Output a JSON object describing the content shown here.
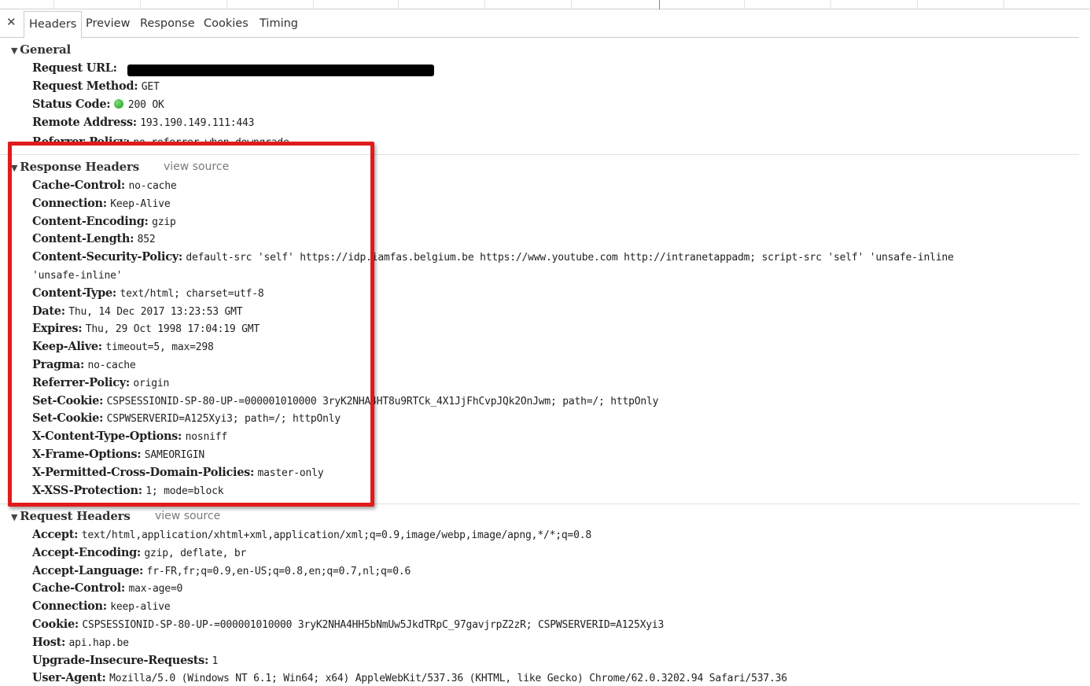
{
  "tabs": [
    "Headers",
    "Preview",
    "Response",
    "Cookies",
    "Timing"
  ],
  "general": {
    "title": "General",
    "rows": [
      {
        "k": "Request URL:",
        "v": ""
      },
      {
        "k": "Request Method:",
        "v": "GET"
      },
      {
        "k": "Status Code:",
        "v": "200 OK"
      },
      {
        "k": "Remote Address:",
        "v": "193.190.149.111:443"
      },
      {
        "k": "Referrer-Policy:",
        "v": "no-referrer-when-downgrade"
      }
    ]
  },
  "response_headers": {
    "title": "Response Headers",
    "view_source": "view source",
    "rows": [
      {
        "k": "Cache-Control:",
        "v": "no-cache"
      },
      {
        "k": "Connection:",
        "v": "Keep-Alive"
      },
      {
        "k": "Content-Encoding:",
        "v": "gzip"
      },
      {
        "k": "Content-Length:",
        "v": "852"
      },
      {
        "k": "Content-Security-Policy:",
        "v": "default-src 'self' https://idp.iamfas.belgium.be https://www.youtube.com http://intranetappadm; script-src 'self' 'unsafe-inline"
      },
      {
        "k": "",
        "v": "'unsafe-inline'"
      },
      {
        "k": "Content-Type:",
        "v": "text/html; charset=utf-8"
      },
      {
        "k": "Date:",
        "v": "Thu, 14 Dec 2017 13:23:53 GMT"
      },
      {
        "k": "Expires:",
        "v": "Thu, 29 Oct 1998 17:04:19 GMT"
      },
      {
        "k": "Keep-Alive:",
        "v": "timeout=5, max=298"
      },
      {
        "k": "Pragma:",
        "v": "no-cache"
      },
      {
        "k": "Referrer-Policy:",
        "v": "origin"
      },
      {
        "k": "Set-Cookie:",
        "v": "CSPSESSIONID-SP-80-UP-=000001010000 3ryK2NHA4HT8u9RTCk_4X1JjFhCvpJQk2OnJwm; path=/; httpOnly"
      },
      {
        "k": "Set-Cookie:",
        "v": "CSPWSERVERID=A125Xyi3; path=/; httpOnly"
      },
      {
        "k": "X-Content-Type-Options:",
        "v": "nosniff"
      },
      {
        "k": "X-Frame-Options:",
        "v": "SAMEORIGIN"
      },
      {
        "k": "X-Permitted-Cross-Domain-Policies:",
        "v": "master-only"
      },
      {
        "k": "X-XSS-Protection:",
        "v": "1; mode=block"
      }
    ]
  },
  "request_headers": {
    "title": "Request Headers",
    "view_source": "view source",
    "rows": [
      {
        "k": "Accept:",
        "v": "text/html,application/xhtml+xml,application/xml;q=0.9,image/webp,image/apng,*/*;q=0.8"
      },
      {
        "k": "Accept-Encoding:",
        "v": "gzip, deflate, br"
      },
      {
        "k": "Accept-Language:",
        "v": "fr-FR,fr;q=0.9,en-US;q=0.8,en;q=0.7,nl;q=0.6"
      },
      {
        "k": "Cache-Control:",
        "v": "max-age=0"
      },
      {
        "k": "Connection:",
        "v": "keep-alive"
      },
      {
        "k": "Cookie:",
        "v": "CSPSESSIONID-SP-80-UP-=000001010000 3ryK2NHA4HH5bNmUw5JkdTRpC_97gavjrpZ2zR; CSPWSERVERID=A125Xyi3"
      },
      {
        "k": "Host:",
        "v": "api.hap.be"
      },
      {
        "k": "Upgrade-Insecure-Requests:",
        "v": "1"
      },
      {
        "k": "User-Agent:",
        "v": "Mozilla/5.0 (Windows NT 6.1; Win64; x64) AppleWebKit/537.36 (KHTML, like Gecko) Chrome/62.0.3202.94 Safari/537.36"
      }
    ]
  },
  "colors": {
    "highlight": "#e11b1b",
    "status_ok": "#1e9a1e"
  }
}
